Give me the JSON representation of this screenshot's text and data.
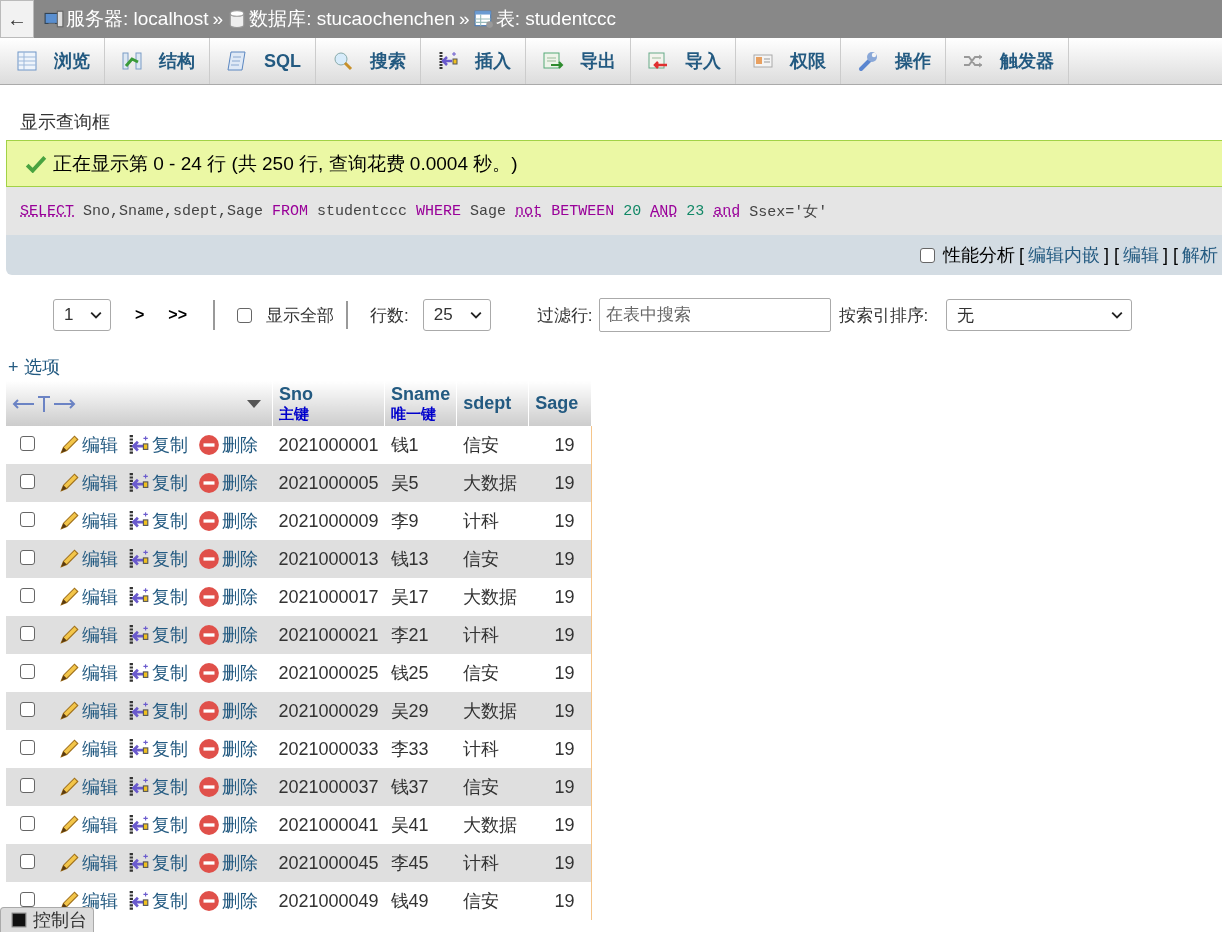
{
  "breadcrumb": {
    "back": "←",
    "parts": [
      {
        "kind": "server",
        "text": "服务器: localhost"
      },
      {
        "kind": "database",
        "text": "数据库: stucaochenchen"
      },
      {
        "kind": "table",
        "text": "表: studentccc"
      }
    ],
    "separator": "»"
  },
  "tabs": [
    {
      "label": "浏览",
      "selected": false
    },
    {
      "label": "结构",
      "selected": false
    },
    {
      "label": "SQL",
      "selected": false
    },
    {
      "label": "搜索",
      "selected": false
    },
    {
      "label": "插入",
      "selected": false
    },
    {
      "label": "导出",
      "selected": false
    },
    {
      "label": "导入",
      "selected": false
    },
    {
      "label": "权限",
      "selected": false
    },
    {
      "label": "操作",
      "selected": false
    },
    {
      "label": "触发器",
      "selected": false
    }
  ],
  "query_toggle": "显示查询框",
  "success_message": "正在显示第 0 - 24 行 (共 250 行, 查询花费 0.0004 秒。)",
  "sql": [
    {
      "kind": "func",
      "text": "SELECT"
    },
    {
      "kind": "plain",
      "text": "Sno,Sname,sdept,Sage"
    },
    {
      "kind": "keyword",
      "text": "FROM"
    },
    {
      "kind": "plain",
      "text": "studentccc"
    },
    {
      "kind": "keyword",
      "text": "WHERE"
    },
    {
      "kind": "plain",
      "text": "Sage"
    },
    {
      "kind": "func",
      "text": "not"
    },
    {
      "kind": "keyword",
      "text": "BETWEEN"
    },
    {
      "kind": "number",
      "text": "20"
    },
    {
      "kind": "func",
      "text": "AND"
    },
    {
      "kind": "number",
      "text": "23"
    },
    {
      "kind": "func",
      "text": "and"
    },
    {
      "kind": "plain",
      "text": "Ssex='女'"
    }
  ],
  "query_links": {
    "profiling": {
      "label": "性能分析",
      "checked": false
    },
    "parts": [
      {
        "kind": "text",
        "text": "["
      },
      {
        "kind": "link",
        "text": "编辑内嵌"
      },
      {
        "kind": "text",
        "text": "] ["
      },
      {
        "kind": "link",
        "text": "编辑"
      },
      {
        "kind": "text",
        "text": "] ["
      },
      {
        "kind": "link",
        "text": "解析"
      }
    ]
  },
  "pagination": {
    "page": "1",
    "next": ">",
    "last": ">>",
    "show_all": {
      "label": "显示全部",
      "checked": false
    },
    "rows_label": "行数:",
    "rows": "25",
    "filter_label": "过滤行:",
    "filter_placeholder": "在表中搜索",
    "sort_label": "按索引排序:",
    "sort": "无"
  },
  "options": "+ 选项",
  "table": {
    "columns": [
      {
        "label": "Sno",
        "sub": "主键"
      },
      {
        "label": "Sname",
        "sub": "唯一键"
      },
      {
        "label": "sdept"
      },
      {
        "label": "Sage"
      }
    ],
    "rows": [
      {
        "checked": false,
        "actions": [
          "编辑",
          "复制",
          "删除"
        ],
        "cells": [
          "2021000001",
          "钱1",
          "信安",
          "19"
        ]
      },
      {
        "checked": false,
        "actions": [
          "编辑",
          "复制",
          "删除"
        ],
        "cells": [
          "2021000005",
          "吴5",
          "大数据",
          "19"
        ]
      },
      {
        "checked": false,
        "actions": [
          "编辑",
          "复制",
          "删除"
        ],
        "cells": [
          "2021000009",
          "李9",
          "计科",
          "19"
        ]
      },
      {
        "checked": false,
        "actions": [
          "编辑",
          "复制",
          "删除"
        ],
        "cells": [
          "2021000013",
          "钱13",
          "信安",
          "19"
        ]
      },
      {
        "checked": false,
        "actions": [
          "编辑",
          "复制",
          "删除"
        ],
        "cells": [
          "2021000017",
          "吴17",
          "大数据",
          "19"
        ]
      },
      {
        "checked": false,
        "actions": [
          "编辑",
          "复制",
          "删除"
        ],
        "cells": [
          "2021000021",
          "李21",
          "计科",
          "19"
        ]
      },
      {
        "checked": false,
        "actions": [
          "编辑",
          "复制",
          "删除"
        ],
        "cells": [
          "2021000025",
          "钱25",
          "信安",
          "19"
        ]
      },
      {
        "checked": false,
        "actions": [
          "编辑",
          "复制",
          "删除"
        ],
        "cells": [
          "2021000029",
          "吴29",
          "大数据",
          "19"
        ]
      },
      {
        "checked": false,
        "actions": [
          "编辑",
          "复制",
          "删除"
        ],
        "cells": [
          "2021000033",
          "李33",
          "计科",
          "19"
        ]
      },
      {
        "checked": false,
        "actions": [
          "编辑",
          "复制",
          "删除"
        ],
        "cells": [
          "2021000037",
          "钱37",
          "信安",
          "19"
        ]
      },
      {
        "checked": false,
        "actions": [
          "编辑",
          "复制",
          "删除"
        ],
        "cells": [
          "2021000041",
          "吴41",
          "大数据",
          "19"
        ]
      },
      {
        "checked": false,
        "actions": [
          "编辑",
          "复制",
          "删除"
        ],
        "cells": [
          "2021000045",
          "李45",
          "计科",
          "19"
        ]
      },
      {
        "checked": false,
        "actions": [
          "编辑",
          "复制",
          "删除"
        ],
        "cells": [
          "2021000049",
          "钱49",
          "信安",
          "19"
        ]
      }
    ]
  },
  "console": "控制台"
}
